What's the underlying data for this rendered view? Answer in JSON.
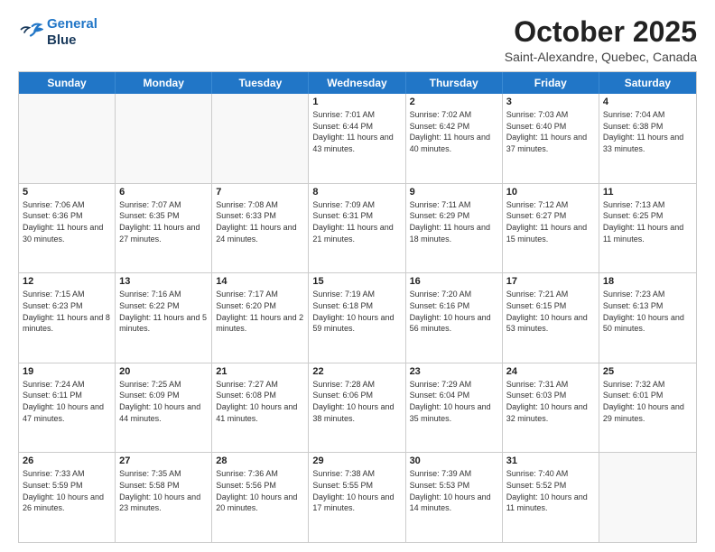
{
  "header": {
    "logo_line1": "General",
    "logo_line2": "Blue",
    "month": "October 2025",
    "location": "Saint-Alexandre, Quebec, Canada"
  },
  "days_of_week": [
    "Sunday",
    "Monday",
    "Tuesday",
    "Wednesday",
    "Thursday",
    "Friday",
    "Saturday"
  ],
  "weeks": [
    [
      {
        "day": "",
        "info": ""
      },
      {
        "day": "",
        "info": ""
      },
      {
        "day": "",
        "info": ""
      },
      {
        "day": "1",
        "info": "Sunrise: 7:01 AM\nSunset: 6:44 PM\nDaylight: 11 hours\nand 43 minutes."
      },
      {
        "day": "2",
        "info": "Sunrise: 7:02 AM\nSunset: 6:42 PM\nDaylight: 11 hours\nand 40 minutes."
      },
      {
        "day": "3",
        "info": "Sunrise: 7:03 AM\nSunset: 6:40 PM\nDaylight: 11 hours\nand 37 minutes."
      },
      {
        "day": "4",
        "info": "Sunrise: 7:04 AM\nSunset: 6:38 PM\nDaylight: 11 hours\nand 33 minutes."
      }
    ],
    [
      {
        "day": "5",
        "info": "Sunrise: 7:06 AM\nSunset: 6:36 PM\nDaylight: 11 hours\nand 30 minutes."
      },
      {
        "day": "6",
        "info": "Sunrise: 7:07 AM\nSunset: 6:35 PM\nDaylight: 11 hours\nand 27 minutes."
      },
      {
        "day": "7",
        "info": "Sunrise: 7:08 AM\nSunset: 6:33 PM\nDaylight: 11 hours\nand 24 minutes."
      },
      {
        "day": "8",
        "info": "Sunrise: 7:09 AM\nSunset: 6:31 PM\nDaylight: 11 hours\nand 21 minutes."
      },
      {
        "day": "9",
        "info": "Sunrise: 7:11 AM\nSunset: 6:29 PM\nDaylight: 11 hours\nand 18 minutes."
      },
      {
        "day": "10",
        "info": "Sunrise: 7:12 AM\nSunset: 6:27 PM\nDaylight: 11 hours\nand 15 minutes."
      },
      {
        "day": "11",
        "info": "Sunrise: 7:13 AM\nSunset: 6:25 PM\nDaylight: 11 hours\nand 11 minutes."
      }
    ],
    [
      {
        "day": "12",
        "info": "Sunrise: 7:15 AM\nSunset: 6:23 PM\nDaylight: 11 hours\nand 8 minutes."
      },
      {
        "day": "13",
        "info": "Sunrise: 7:16 AM\nSunset: 6:22 PM\nDaylight: 11 hours\nand 5 minutes."
      },
      {
        "day": "14",
        "info": "Sunrise: 7:17 AM\nSunset: 6:20 PM\nDaylight: 11 hours\nand 2 minutes."
      },
      {
        "day": "15",
        "info": "Sunrise: 7:19 AM\nSunset: 6:18 PM\nDaylight: 10 hours\nand 59 minutes."
      },
      {
        "day": "16",
        "info": "Sunrise: 7:20 AM\nSunset: 6:16 PM\nDaylight: 10 hours\nand 56 minutes."
      },
      {
        "day": "17",
        "info": "Sunrise: 7:21 AM\nSunset: 6:15 PM\nDaylight: 10 hours\nand 53 minutes."
      },
      {
        "day": "18",
        "info": "Sunrise: 7:23 AM\nSunset: 6:13 PM\nDaylight: 10 hours\nand 50 minutes."
      }
    ],
    [
      {
        "day": "19",
        "info": "Sunrise: 7:24 AM\nSunset: 6:11 PM\nDaylight: 10 hours\nand 47 minutes."
      },
      {
        "day": "20",
        "info": "Sunrise: 7:25 AM\nSunset: 6:09 PM\nDaylight: 10 hours\nand 44 minutes."
      },
      {
        "day": "21",
        "info": "Sunrise: 7:27 AM\nSunset: 6:08 PM\nDaylight: 10 hours\nand 41 minutes."
      },
      {
        "day": "22",
        "info": "Sunrise: 7:28 AM\nSunset: 6:06 PM\nDaylight: 10 hours\nand 38 minutes."
      },
      {
        "day": "23",
        "info": "Sunrise: 7:29 AM\nSunset: 6:04 PM\nDaylight: 10 hours\nand 35 minutes."
      },
      {
        "day": "24",
        "info": "Sunrise: 7:31 AM\nSunset: 6:03 PM\nDaylight: 10 hours\nand 32 minutes."
      },
      {
        "day": "25",
        "info": "Sunrise: 7:32 AM\nSunset: 6:01 PM\nDaylight: 10 hours\nand 29 minutes."
      }
    ],
    [
      {
        "day": "26",
        "info": "Sunrise: 7:33 AM\nSunset: 5:59 PM\nDaylight: 10 hours\nand 26 minutes."
      },
      {
        "day": "27",
        "info": "Sunrise: 7:35 AM\nSunset: 5:58 PM\nDaylight: 10 hours\nand 23 minutes."
      },
      {
        "day": "28",
        "info": "Sunrise: 7:36 AM\nSunset: 5:56 PM\nDaylight: 10 hours\nand 20 minutes."
      },
      {
        "day": "29",
        "info": "Sunrise: 7:38 AM\nSunset: 5:55 PM\nDaylight: 10 hours\nand 17 minutes."
      },
      {
        "day": "30",
        "info": "Sunrise: 7:39 AM\nSunset: 5:53 PM\nDaylight: 10 hours\nand 14 minutes."
      },
      {
        "day": "31",
        "info": "Sunrise: 7:40 AM\nSunset: 5:52 PM\nDaylight: 10 hours\nand 11 minutes."
      },
      {
        "day": "",
        "info": ""
      }
    ]
  ]
}
